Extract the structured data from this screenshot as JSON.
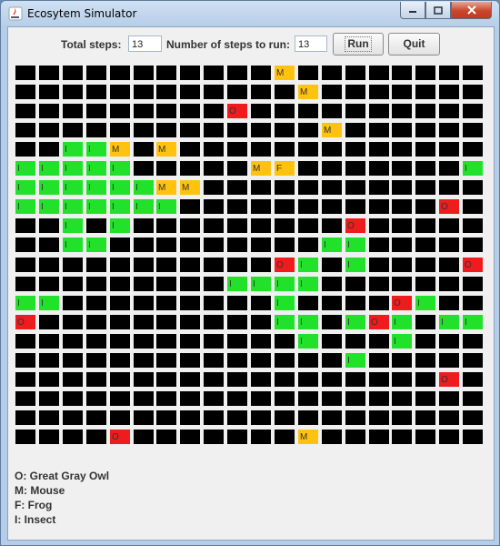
{
  "window": {
    "title": "Ecosytem Simulator"
  },
  "toolbar": {
    "total_steps_label": "Total steps:",
    "total_steps_value": "13",
    "steps_to_run_label": "Number of steps to run:",
    "steps_to_run_value": "13",
    "run_label": "Run",
    "quit_label": "Quit"
  },
  "grid": {
    "rows": [
      "...........M........",
      "............M.......",
      ".........O..........",
      ".............M......",
      "..IIM.M.............",
      "IIIII.....MF.......I",
      "IIIIIIMM............",
      "IIIIIII...........O.",
      "..I.I.........O.....",
      "..II.........II.....",
      "...........OI.I....O",
      ".........IIII.......",
      "II.........I....OI..",
      "O..........II.IOI.II",
      "............I...I...",
      "..............I.....",
      "..................O.",
      "....................",
      "....................",
      "....O.......M......."
    ]
  },
  "legend": [
    {
      "key": "O",
      "text": "O: Great Gray Owl"
    },
    {
      "key": "M",
      "text": "M: Mouse"
    },
    {
      "key": "F",
      "text": "F: Frog"
    },
    {
      "key": "I",
      "text": "I: Insect"
    }
  ],
  "colors": {
    "owl": "#ee1c1c",
    "mouse": "#ffc20e",
    "frog": "#ffc20e",
    "insect": "#21e12a",
    "empty": "#000000"
  }
}
